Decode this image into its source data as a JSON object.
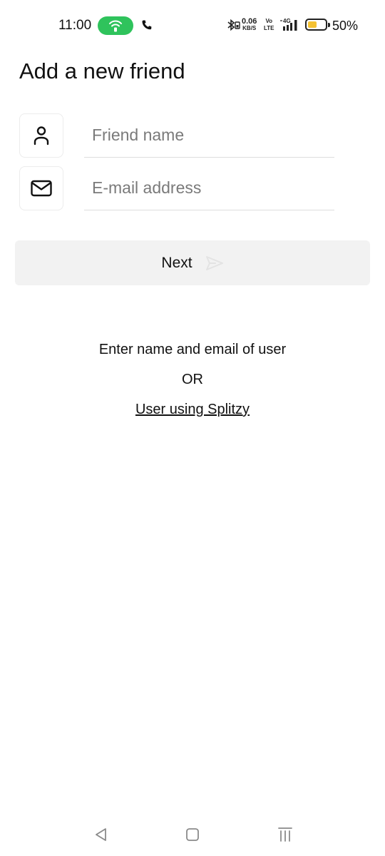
{
  "status_bar": {
    "time": "11:00",
    "net_speed_value": "0.06",
    "net_speed_unit": "KB/S",
    "volte_top": "Vo",
    "volte_bottom": "LTE",
    "network_type": "4G",
    "battery_percent": "50%",
    "battery_level": 0.5,
    "hotspot_color": "#2fc35c",
    "battery_fill_color": "#f5c232"
  },
  "page": {
    "title": "Add a new friend"
  },
  "form": {
    "name_field": {
      "icon": "person-icon",
      "placeholder": "Friend name",
      "value": ""
    },
    "email_field": {
      "icon": "mail-icon",
      "placeholder": "E-mail address",
      "value": ""
    }
  },
  "next_button": {
    "label": "Next",
    "icon": "send-icon"
  },
  "helper": {
    "instruction": "Enter name and email of user",
    "or_text": "OR",
    "link_text": "User using Splitzy"
  },
  "nav_bar": {
    "back_icon": "back-triangle-icon",
    "home_icon": "home-square-icon",
    "recents_icon": "recents-menu-icon"
  }
}
